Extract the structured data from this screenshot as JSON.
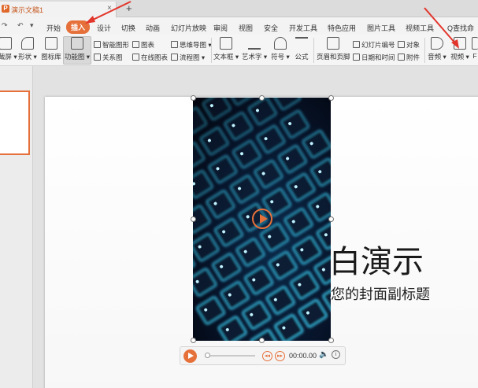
{
  "titlebar": {
    "doc_title": "演示文稿1",
    "close_glyph": "×",
    "new_tab_glyph": "+"
  },
  "quick_access": {
    "redo": "↷",
    "undo": "↶",
    "more": "▾"
  },
  "menu": [
    {
      "id": "home",
      "label": "开始"
    },
    {
      "id": "insert",
      "label": "插入",
      "active": true
    },
    {
      "id": "design",
      "label": "设计"
    },
    {
      "id": "transition",
      "label": "切换"
    },
    {
      "id": "animation",
      "label": "动画"
    },
    {
      "id": "slideshow",
      "label": "幻灯片放映"
    },
    {
      "id": "review",
      "label": "审阅"
    },
    {
      "id": "view",
      "label": "视图"
    },
    {
      "id": "security",
      "label": "安全"
    },
    {
      "id": "devtools",
      "label": "开发工具"
    },
    {
      "id": "special",
      "label": "特色应用"
    },
    {
      "id": "picture_tools",
      "label": "图片工具"
    },
    {
      "id": "video_tools",
      "label": "视频工具"
    }
  ],
  "search_command": "Q查找命",
  "ribbon": {
    "screenshot": "截屏 ▾",
    "shapes": "形状 ▾",
    "icon_lib": "图标库",
    "function_chart": "功能图 ▾",
    "smart_shape": "智能图形",
    "chart": "图表",
    "mindmap": "思维导图 ▾",
    "relation": "关系图",
    "online_chart": "在线图表",
    "flowchart": "流程图 ▾",
    "textbox": "文本框 ▾",
    "wordart": "艺术字 ▾",
    "symbol": "符号 ▾",
    "formula": "公式",
    "header_footer": "页眉和页脚",
    "slide_number": "幻灯片编号",
    "object": "对象",
    "datetime": "日期和时间",
    "attachment": "附件",
    "audio": "音频 ▾",
    "video": "视频 ▾",
    "more": "F"
  },
  "slide": {
    "title": "白演示",
    "subtitle": "您的封面副标题"
  },
  "player": {
    "time": "00:00.00",
    "prev": "◂◂",
    "next": "▸▸",
    "volume_glyph": "🔈",
    "info_glyph": "i"
  },
  "colors": {
    "accent": "#e6703a",
    "arrow": "#e2352b",
    "key_glow": "#3fd6ff"
  }
}
